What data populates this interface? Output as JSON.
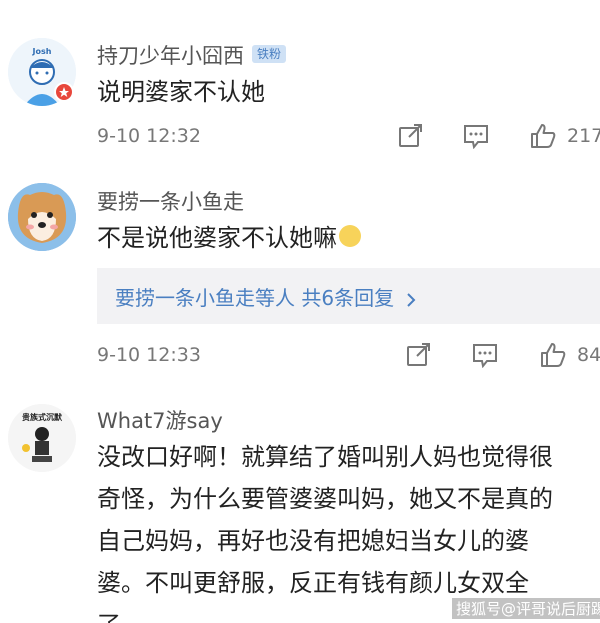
{
  "comments": [
    {
      "username": "持刀少年小囧西",
      "badge": "铁粉",
      "avatar_text": "Josh",
      "text": "说明婆家不认她",
      "time": "9-10 12:32",
      "likes": "217"
    },
    {
      "username": "要捞一条小鱼走",
      "text": "不是说他婆家不认她嘛",
      "emoji": "😷",
      "time": "9-10 12:33",
      "likes": "84",
      "replies": {
        "user": "要捞一条小鱼走",
        "summary": "等人  共6条回复"
      }
    },
    {
      "username": "What7游say",
      "avatar_text": "贵族式沉默",
      "lines": [
        "没改口好啊！就算结了婚叫别人妈也觉得很",
        "奇怪，为什么要管婆婆叫妈，她又不是真的",
        "自己妈妈，再好也没有把媳妇当女儿的婆",
        "婆。不叫更舒服，反正有钱有颜儿女双全",
        "了。"
      ]
    }
  ],
  "watermark": "搜狐号@评哥说后厨踢球",
  "icons": [
    "repost-icon",
    "comment-icon",
    "like-icon"
  ],
  "colors": {
    "link": "#4a7fc1",
    "badge_bg": "#cfe1f5",
    "reply_bg": "#f2f2f4"
  }
}
